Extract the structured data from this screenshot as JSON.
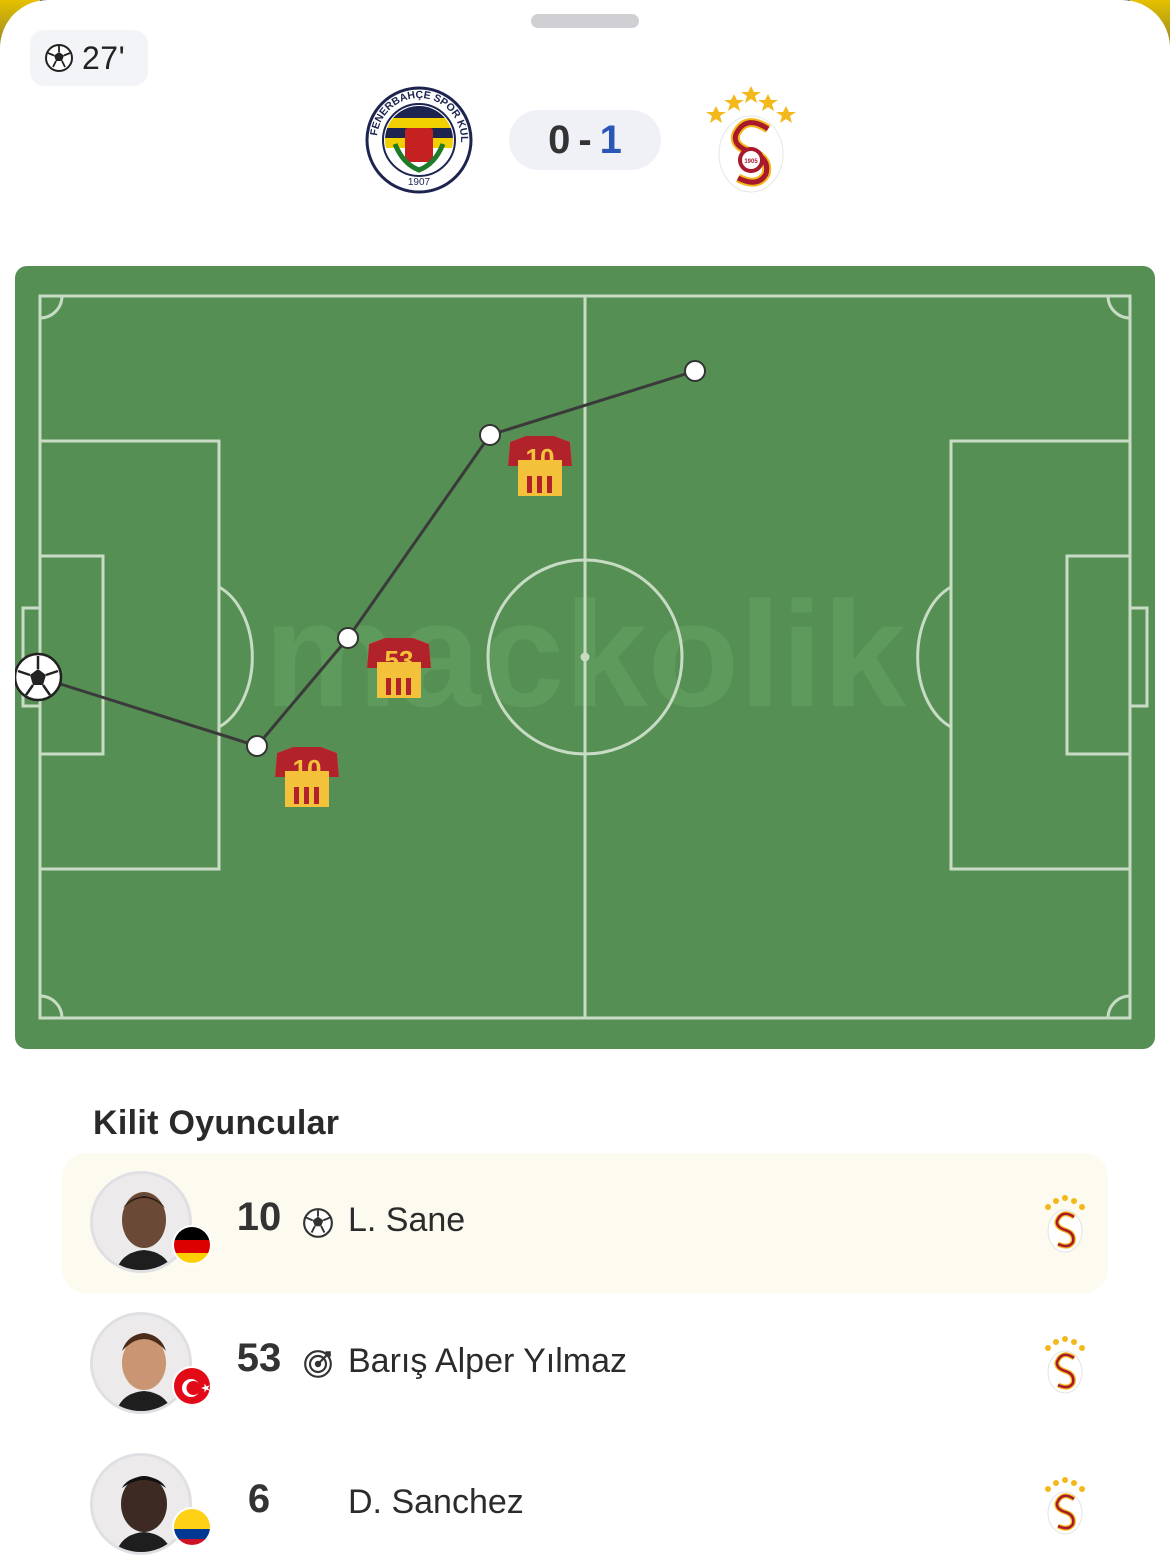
{
  "match": {
    "minute": "27'",
    "score_home": "0",
    "score_separator": "-",
    "score_away": "1",
    "home_team_icon": "fenerbahce-crest",
    "away_team_icon": "galatasaray-crest",
    "home_crest_text": "FENERBAHÇE SPOR KULÜBÜ",
    "home_crest_year": "1907",
    "away_crest_year": "1905"
  },
  "pitch": {
    "watermark": "mackolik",
    "colors": {
      "grass": "#568f53",
      "lines": "#c9dcc6",
      "jersey_yellow": "#f4c23a",
      "jersey_red": "#b2222a"
    },
    "play_markers": [
      {
        "number": "10"
      },
      {
        "number": "53"
      },
      {
        "number": "10"
      }
    ]
  },
  "key_players": {
    "title": "Kilit Oyuncular",
    "players": [
      {
        "number": "10",
        "event_icon": "goal-ball-icon",
        "name": "L. Sane",
        "flag": "germany",
        "team_icon": "galatasaray-crest",
        "highlighted": true
      },
      {
        "number": "53",
        "event_icon": "assist-target-icon",
        "name": "Barış Alper Yılmaz",
        "flag": "turkey",
        "team_icon": "galatasaray-crest",
        "highlighted": false
      },
      {
        "number": "6",
        "event_icon": "",
        "name": "D. Sanchez",
        "flag": "colombia",
        "team_icon": "galatasaray-crest",
        "highlighted": false
      }
    ]
  }
}
